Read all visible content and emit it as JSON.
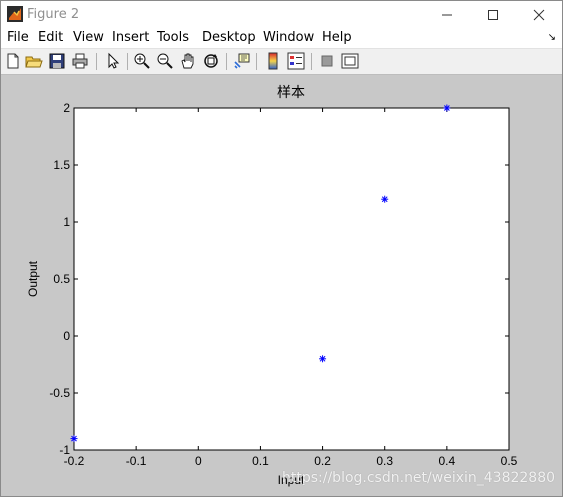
{
  "window": {
    "title": "Figure 2",
    "minimize_icon": "minimize-icon",
    "maximize_icon": "maximize-icon",
    "close_icon": "close-icon"
  },
  "menu": {
    "items": [
      "File",
      "Edit",
      "View",
      "Insert",
      "Tools",
      "Desktop",
      "Window",
      "Help"
    ],
    "overflow_symbol": "↘"
  },
  "toolbar": {
    "icons": [
      "new-figure-icon",
      "open-file-icon",
      "save-icon",
      "print-icon",
      "select-arrow-icon",
      "zoom-in-icon",
      "zoom-out-icon",
      "pan-hand-icon",
      "rotate-3d-icon",
      "data-cursor-icon",
      "colorbar-icon",
      "legend-icon",
      "hide-plot-tools-icon",
      "show-plot-tools-icon"
    ]
  },
  "chart_data": {
    "type": "scatter",
    "title": "样本",
    "xlabel": "Input",
    "ylabel": "Output",
    "xlim": [
      -0.2,
      0.5
    ],
    "ylim": [
      -1,
      2
    ],
    "xticks": [
      "-0.2",
      "-0.1",
      "0",
      "0.1",
      "0.2",
      "0.3",
      "0.4",
      "0.5"
    ],
    "yticks": [
      "-1",
      "-0.5",
      "0",
      "0.5",
      "1",
      "1.5",
      "2"
    ],
    "marker": "*",
    "marker_color": "#0000ff",
    "grid": false,
    "points": [
      {
        "x": -0.2,
        "y": -0.9
      },
      {
        "x": 0.2,
        "y": -0.2
      },
      {
        "x": 0.3,
        "y": 1.2
      },
      {
        "x": 0.4,
        "y": 2.0
      }
    ]
  },
  "watermark": "https://blog.csdn.net/weixin_43822880"
}
